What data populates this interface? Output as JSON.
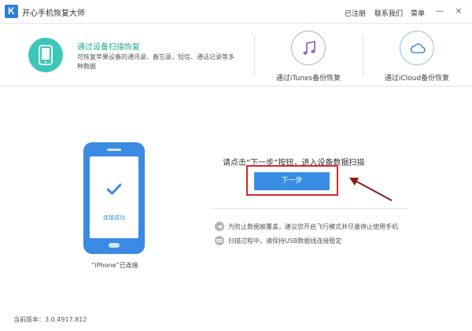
{
  "window": {
    "logo_letter": "K",
    "title": "开心手机恢复大师",
    "menu": [
      "已注册",
      "联系我们",
      "菜单"
    ],
    "controls": [
      "—",
      "×"
    ]
  },
  "modes": {
    "device": {
      "title": "通过设备扫描恢复",
      "description": "可恢复苹果设备的通讯录、备忘录、短信、通话记录等多种数据",
      "icon": "phone-icon"
    },
    "itunes": {
      "label": "通过iTunes备份恢复",
      "icon": "music-note-icon"
    },
    "icloud": {
      "label": "通过iCloud备份恢复",
      "icon": "cloud-icon"
    }
  },
  "device_panel": {
    "status_on_screen": "连接成功",
    "caption": "“iPhone”已连接"
  },
  "scan": {
    "instruction": "请点击“下一步”按钮，进入设备数据扫描",
    "next_button": "下一步"
  },
  "tips": [
    {
      "icon": "airplane-icon",
      "text": "为防止数据被覆盖，建议您开启飞行模式并尽量停止使用手机"
    },
    {
      "icon": "link-icon",
      "text": "扫描过程中，请保持USB数据线连接稳定"
    }
  ],
  "footer": {
    "version": "当前版本：3.0.4917.812"
  },
  "colors": {
    "accent_blue": "#3a8de4",
    "teal": "#3cc7b8",
    "highlight_red": "#d9262c",
    "arrow": "#8b1a1a"
  }
}
